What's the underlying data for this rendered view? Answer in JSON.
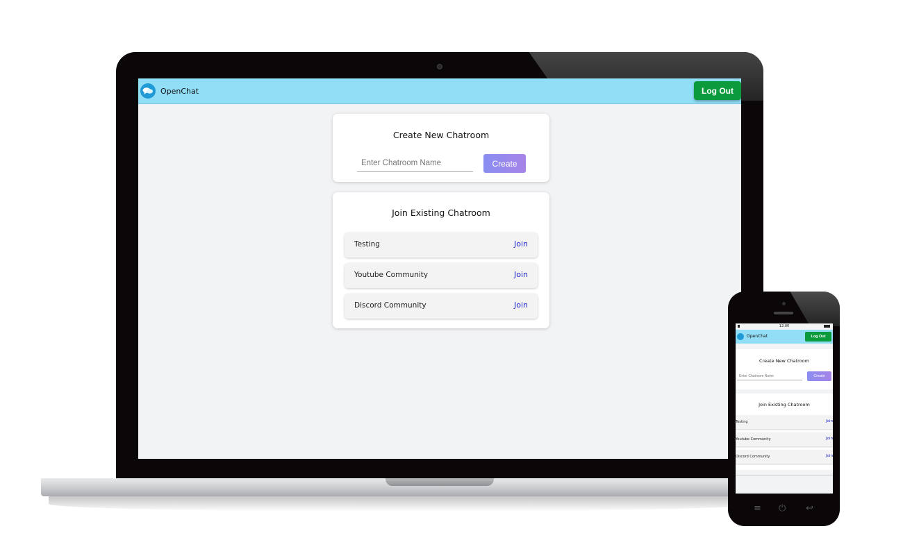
{
  "app": {
    "name": "OpenChat",
    "logout_label": "Log Out"
  },
  "create_card": {
    "title": "Create New Chatroom",
    "input_placeholder": "Enter Chatroom Name",
    "input_value": "",
    "create_label": "Create"
  },
  "join_card": {
    "title": "Join Existing Chatroom",
    "rooms": [
      {
        "name": "Testing",
        "join_label": "Join"
      },
      {
        "name": "Youtube Community",
        "join_label": "Join"
      },
      {
        "name": "Discord Community",
        "join_label": "Join"
      }
    ]
  },
  "phone": {
    "status_time": "12:00"
  },
  "icons": {
    "logo": "chat-bubbles-icon",
    "menu": "menu-icon",
    "power": "power-icon",
    "back": "back-icon"
  },
  "colors": {
    "navbar": "#92def7",
    "logout": "#0b9a3c",
    "create_start": "#8a8df0",
    "create_end": "#a684e8",
    "join_link": "#1a1fc9",
    "page_bg": "#f2f3f5"
  }
}
